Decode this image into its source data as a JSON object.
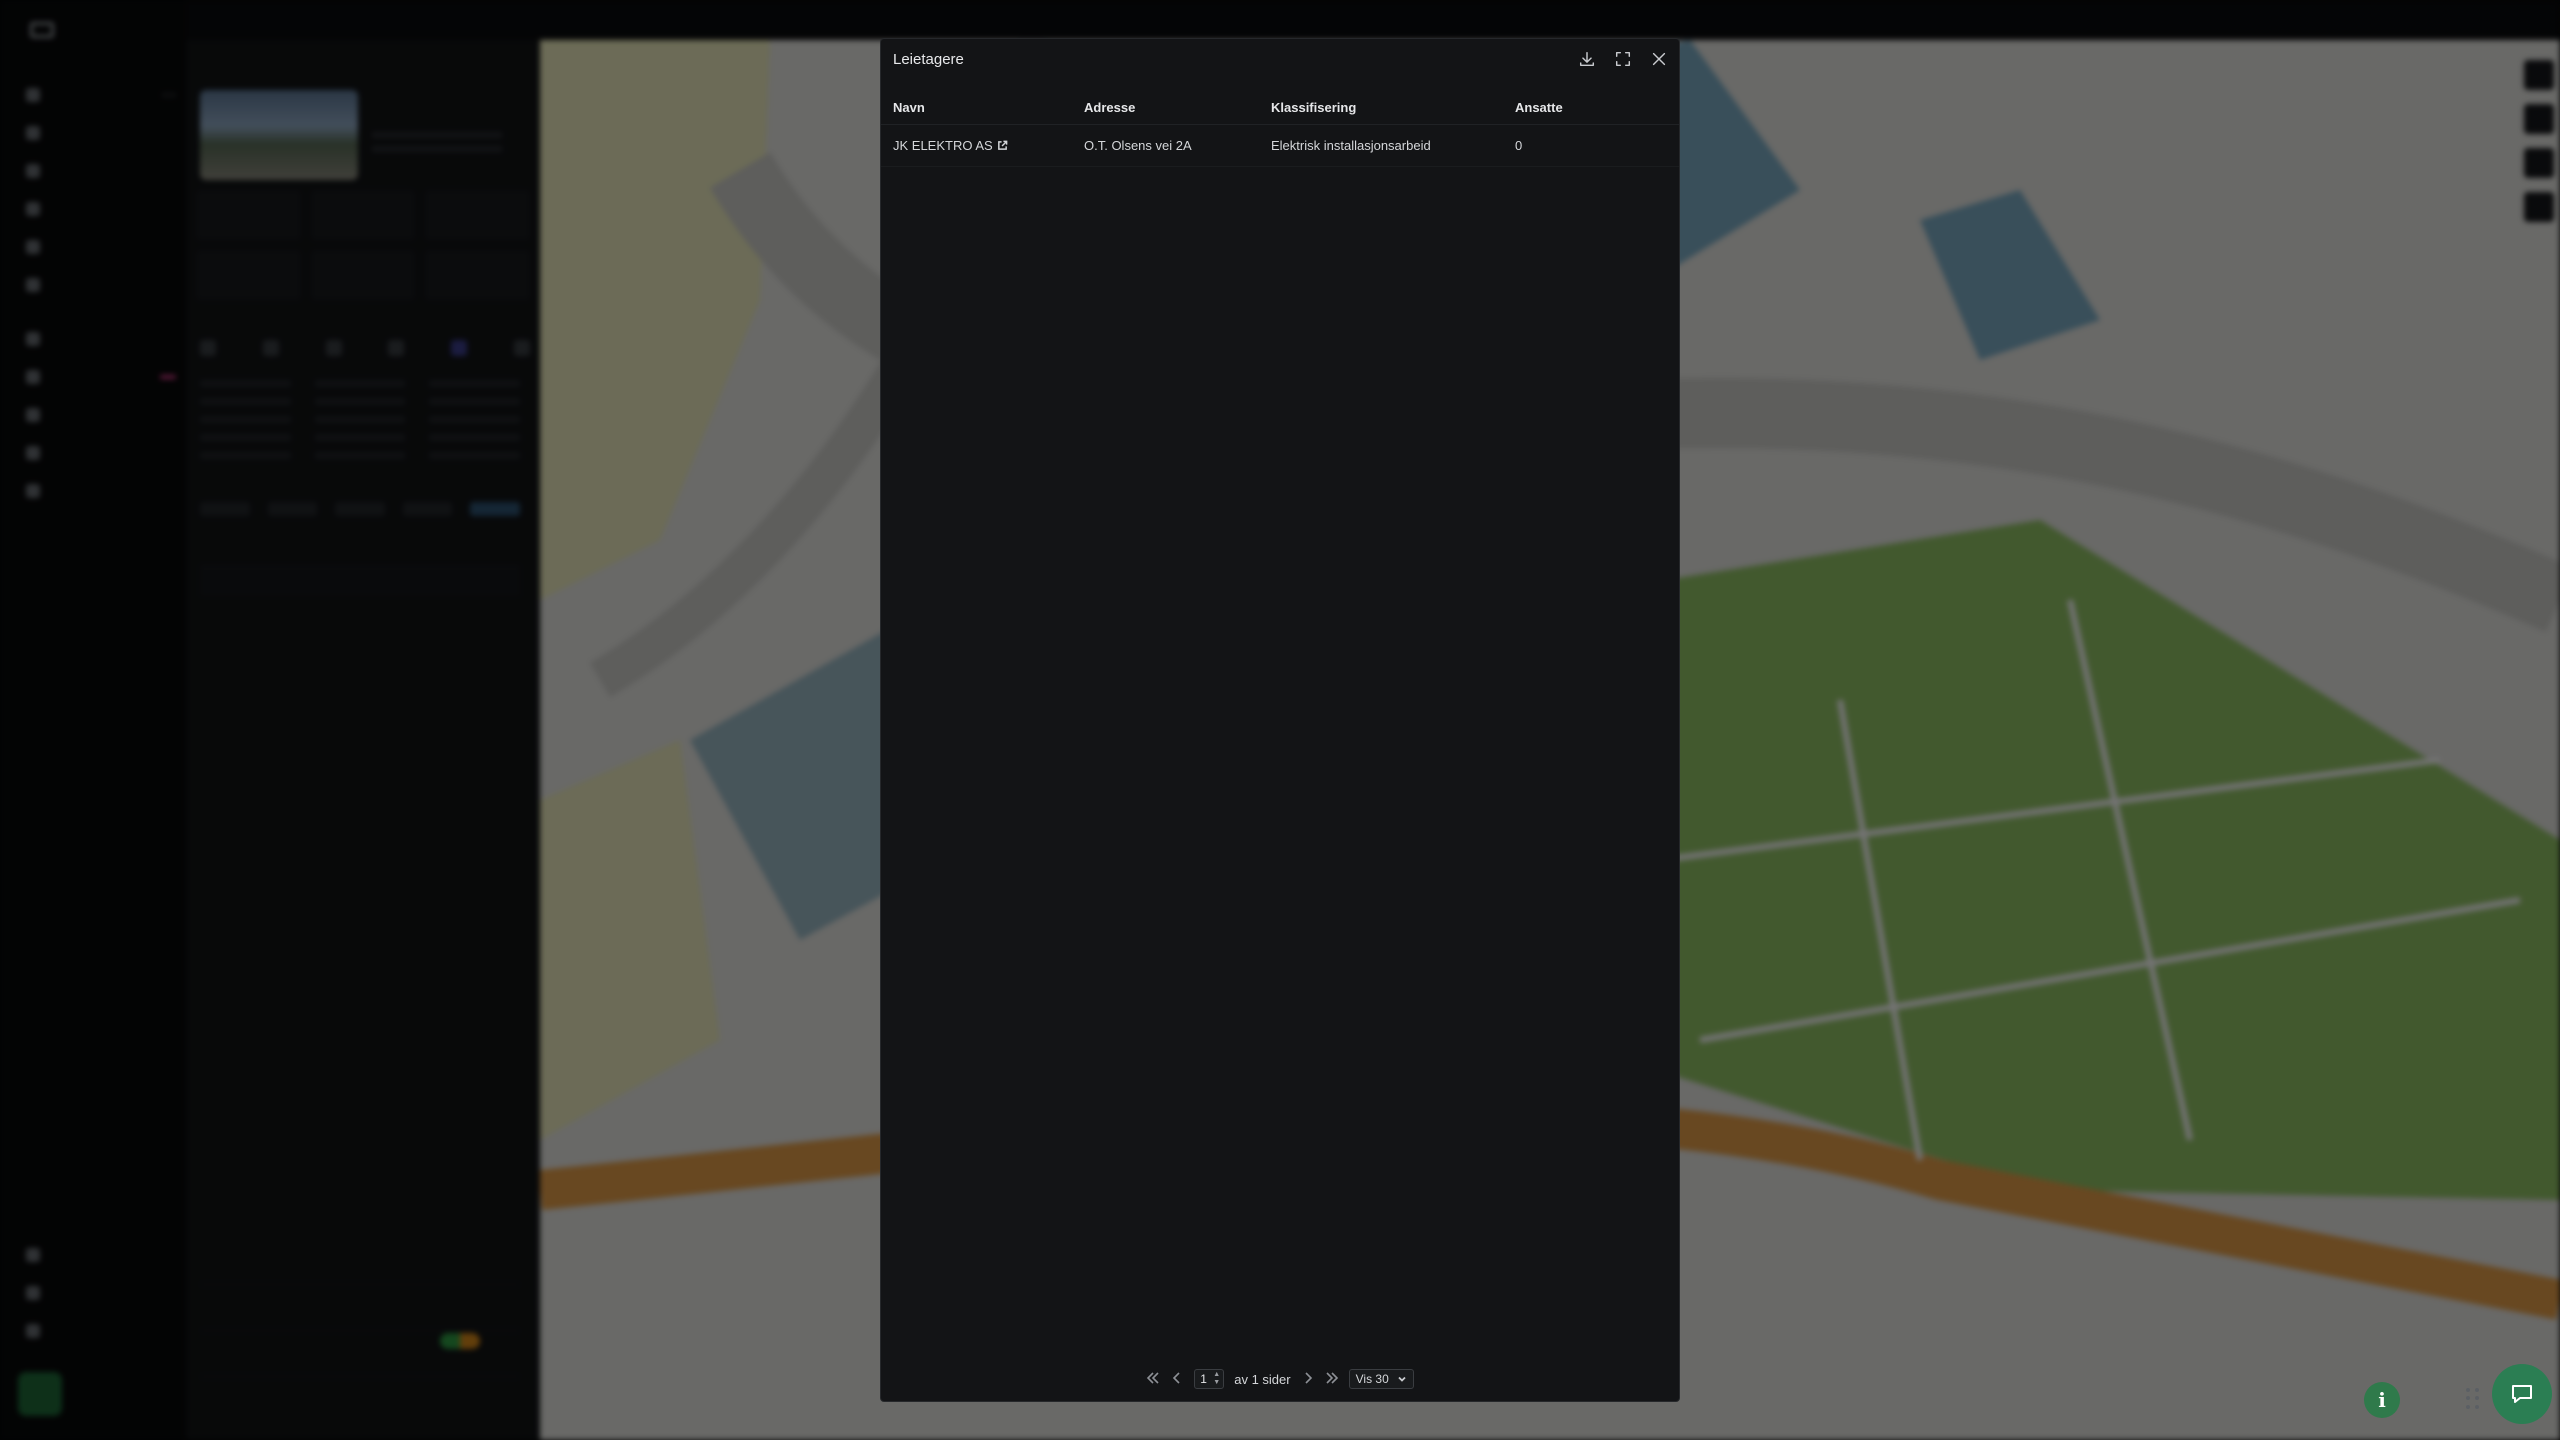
{
  "modal": {
    "title": "Leietagere",
    "columns": [
      "Navn",
      "Adresse",
      "Klassifisering",
      "Ansatte"
    ],
    "rows": [
      {
        "navn": "JK ELEKTRO AS",
        "adresse": "O.T. Olsens vei 2A",
        "klassifisering": "Elektrisk installasjonsarbeid",
        "ansatte": "0"
      }
    ],
    "actions": {
      "download": "download-icon",
      "fullscreen": "fullscreen-icon",
      "close": "close-icon"
    }
  },
  "pager": {
    "page": "1",
    "of_label": "av 1 sider",
    "page_size": "Vis 30"
  },
  "colors": {
    "modal_bg": "#131416",
    "accent_green": "#2b7e53",
    "badge_pink": "#d63c8a"
  }
}
